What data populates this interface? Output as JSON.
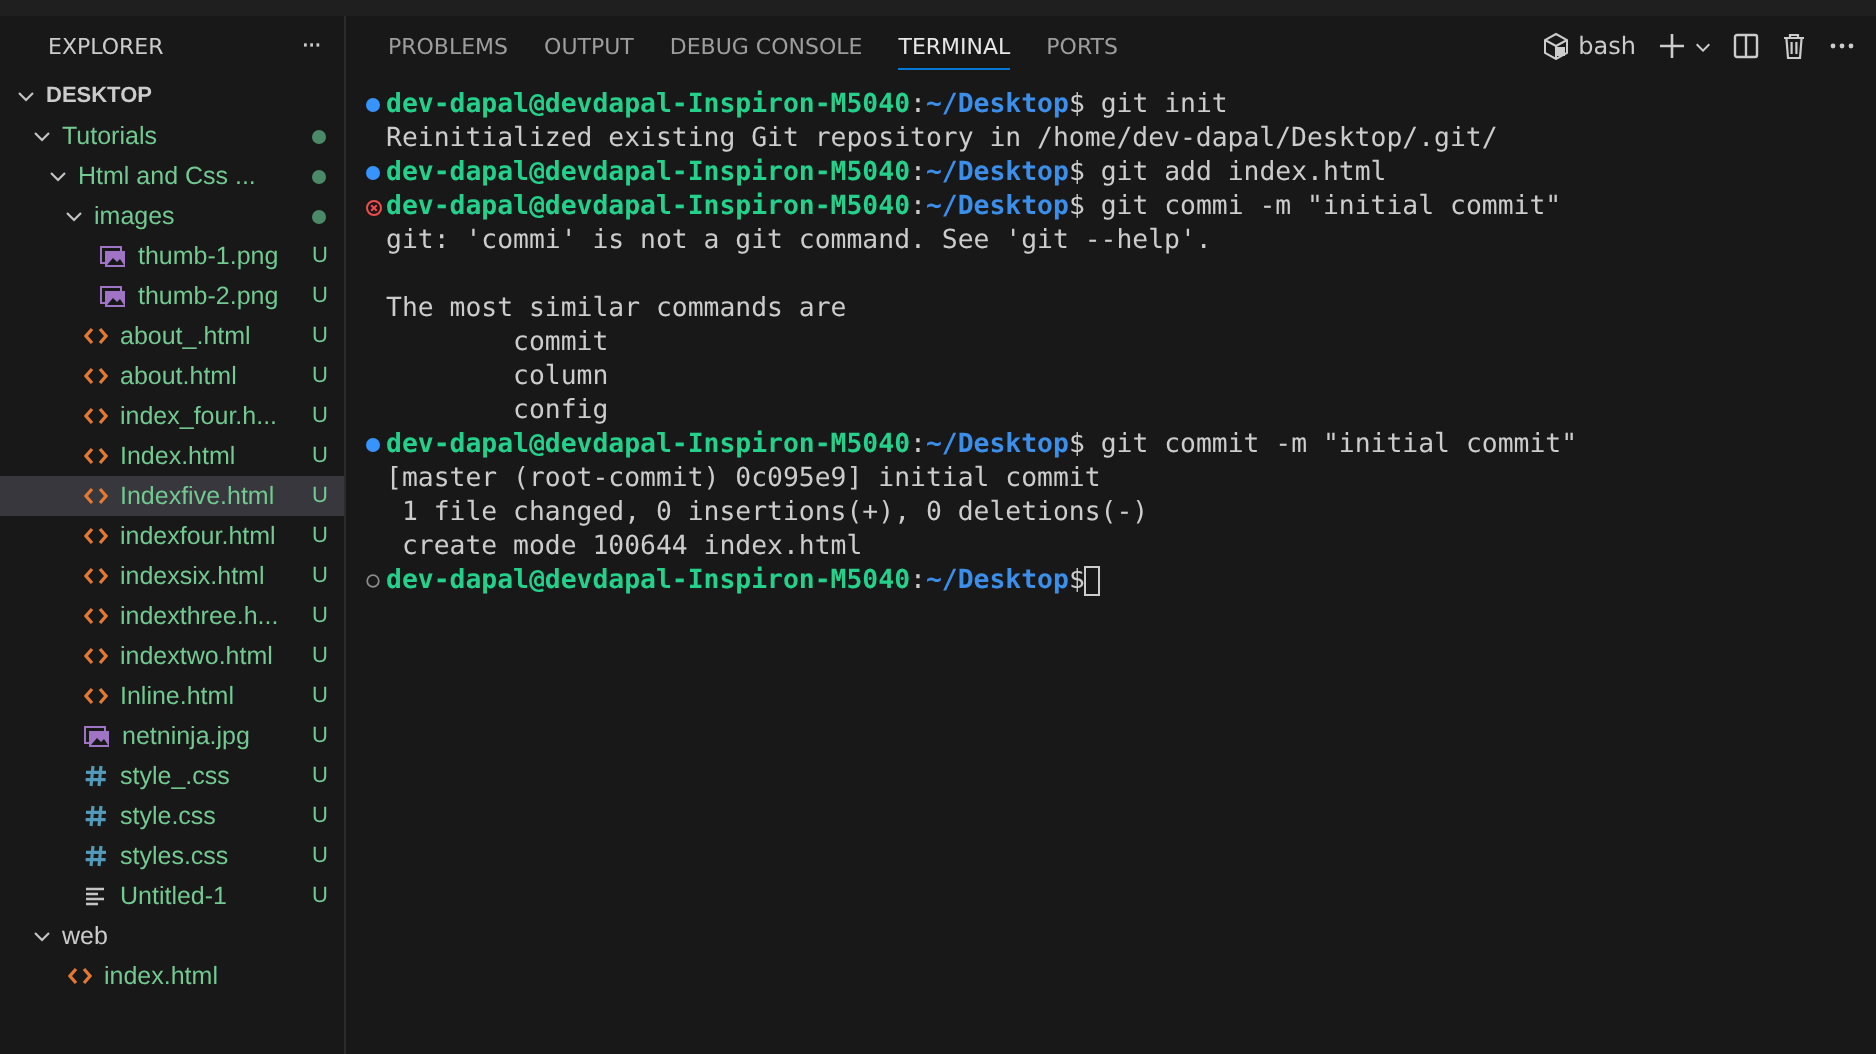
{
  "explorer": {
    "title": "EXPLORER",
    "more": "···",
    "tree": [
      {
        "name": "DESKTOP",
        "kind": "root",
        "expanded": true,
        "children": [
          {
            "name": "Tutorials",
            "kind": "folder",
            "expanded": true,
            "changes": true,
            "children": [
              {
                "name": "Html and Css ...",
                "kind": "folder",
                "expanded": true,
                "changes": true,
                "children": [
                  {
                    "name": "images",
                    "kind": "folder",
                    "expanded": true,
                    "changes": true,
                    "children": [
                      {
                        "name": "thumb-1.png",
                        "kind": "image",
                        "status": "U",
                        "selected": false
                      },
                      {
                        "name": "thumb-2.png",
                        "kind": "image",
                        "status": "U",
                        "selected": false
                      }
                    ]
                  },
                  {
                    "name": "about_.html",
                    "kind": "html",
                    "status": "U",
                    "selected": false
                  },
                  {
                    "name": "about.html",
                    "kind": "html",
                    "status": "U",
                    "selected": false
                  },
                  {
                    "name": "index_four.h...",
                    "kind": "html",
                    "status": "U",
                    "selected": false
                  },
                  {
                    "name": "Index.html",
                    "kind": "html",
                    "status": "U",
                    "selected": false
                  },
                  {
                    "name": "Indexfive.html",
                    "kind": "html",
                    "status": "U",
                    "selected": true
                  },
                  {
                    "name": "indexfour.html",
                    "kind": "html",
                    "status": "U",
                    "selected": false
                  },
                  {
                    "name": "indexsix.html",
                    "kind": "html",
                    "status": "U",
                    "selected": false
                  },
                  {
                    "name": "indexthree.h...",
                    "kind": "html",
                    "status": "U",
                    "selected": false
                  },
                  {
                    "name": "indextwo.html",
                    "kind": "html",
                    "status": "U",
                    "selected": false
                  },
                  {
                    "name": "Inline.html",
                    "kind": "html",
                    "status": "U",
                    "selected": false
                  },
                  {
                    "name": "netninja.jpg",
                    "kind": "image",
                    "status": "U",
                    "selected": false
                  },
                  {
                    "name": "style_.css",
                    "kind": "css",
                    "status": "U",
                    "selected": false
                  },
                  {
                    "name": "style.css",
                    "kind": "css",
                    "status": "U",
                    "selected": false
                  },
                  {
                    "name": "styles.css",
                    "kind": "css",
                    "status": "U",
                    "selected": false
                  },
                  {
                    "name": "Untitled-1",
                    "kind": "text",
                    "status": "U",
                    "selected": false
                  }
                ]
              }
            ]
          },
          {
            "name": "web",
            "kind": "folder",
            "expanded": true,
            "changes": false,
            "children": [
              {
                "name": "index.html",
                "kind": "html",
                "selected": false
              }
            ]
          }
        ]
      }
    ]
  },
  "panel": {
    "tabs": [
      {
        "label": "PROBLEMS",
        "selected": false
      },
      {
        "label": "OUTPUT",
        "selected": false
      },
      {
        "label": "DEBUG CONSOLE",
        "selected": false
      },
      {
        "label": "TERMINAL",
        "selected": true
      },
      {
        "label": "PORTS",
        "selected": false
      }
    ],
    "shell": "bash"
  },
  "terminal": {
    "lines": [
      {
        "kind": "prompt_ok",
        "user": "dev-dapal@devdapal-Inspiron-M5040",
        "separator": ":",
        "path": "~/Desktop",
        "symbol": "$",
        "command": " git init",
        "cursor": false
      },
      {
        "kind": "output",
        "text": "Reinitialized existing Git repository in /home/dev-dapal/Desktop/.git/"
      },
      {
        "kind": "prompt_ok",
        "user": "dev-dapal@devdapal-Inspiron-M5040",
        "separator": ":",
        "path": "~/Desktop",
        "symbol": "$",
        "command": " git add index.html",
        "cursor": false
      },
      {
        "kind": "prompt_error",
        "user": "dev-dapal@devdapal-Inspiron-M5040",
        "separator": ":",
        "path": "~/Desktop",
        "symbol": "$",
        "command": " git commi -m \"initial commit\"",
        "cursor": false
      },
      {
        "kind": "output",
        "text": "git: 'commi' is not a git command. See 'git --help'."
      },
      {
        "kind": "blank"
      },
      {
        "kind": "output",
        "text": "The most similar commands are"
      },
      {
        "kind": "output",
        "text": "        commit"
      },
      {
        "kind": "output",
        "text": "        column"
      },
      {
        "kind": "output",
        "text": "        config"
      },
      {
        "kind": "prompt_ok",
        "user": "dev-dapal@devdapal-Inspiron-M5040",
        "separator": ":",
        "path": "~/Desktop",
        "symbol": "$",
        "command": " git commit -m \"initial commit\"",
        "cursor": false
      },
      {
        "kind": "output",
        "text": "[master (root-commit) 0c095e9] initial commit"
      },
      {
        "kind": "output",
        "text": " 1 file changed, 0 insertions(+), 0 deletions(-)"
      },
      {
        "kind": "output",
        "text": " create mode 100644 index.html"
      },
      {
        "kind": "prompt_idle",
        "user": "dev-dapal@devdapal-Inspiron-M5040",
        "separator": ":",
        "path": "~/Desktop",
        "symbol": "$",
        "cursor": true
      }
    ]
  }
}
